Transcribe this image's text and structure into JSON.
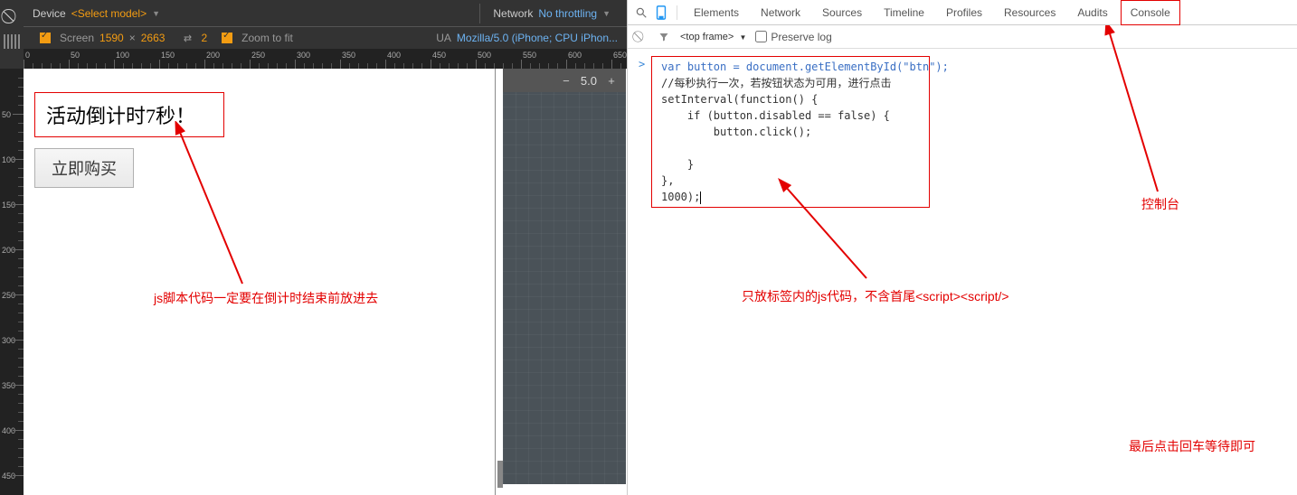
{
  "left": {
    "toolbar": {
      "device_label": "Device",
      "device_value": "<Select model>",
      "network_label": "Network",
      "network_value": "No throttling",
      "screen_label": "Screen",
      "screen_w": "1590",
      "screen_x": "×",
      "screen_h": "2663",
      "pixel_ratio_icon_val": "2",
      "zoom_label": "Zoom to fit",
      "ua_label": "UA",
      "ua_value": "Mozilla/5.0 (iPhone; CPU iPhon..."
    },
    "ruler_h": [
      "0",
      "50",
      "100",
      "150",
      "200",
      "250",
      "300",
      "350",
      "400",
      "450",
      "500",
      "550",
      "600",
      "650"
    ],
    "ruler_v": [
      "50",
      "100",
      "150",
      "200",
      "250",
      "300",
      "350",
      "400",
      "450"
    ],
    "countdown_text": "活动倒计时7秒！",
    "buy_btn": "立即购买",
    "dark_pane": {
      "minus": "−",
      "zoom": "5.0",
      "plus": "+"
    }
  },
  "devtools": {
    "tabs": {
      "elements": "Elements",
      "network": "Network",
      "sources": "Sources",
      "timeline": "Timeline",
      "profiles": "Profiles",
      "resources": "Resources",
      "audits": "Audits",
      "console": "Console"
    },
    "console_bar": {
      "frame": "<top frame>",
      "dropdown": "▼",
      "preserve": "Preserve log"
    },
    "code": {
      "l1": "var button = document.getElementById(\"btn\");",
      "l2": "//每秒执行一次，若按钮状态为可用，进行点击",
      "l3": "setInterval(function() {",
      "l4": "    if (button.disabled == false) {",
      "l5": "        button.click();",
      "l6": "",
      "l7": "    }",
      "l8": "},",
      "l9": "1000);"
    }
  },
  "annotations": {
    "left_note": "js脚本代码一定要在倒计时结束前放进去",
    "mid_note": "只放标签内的js代码，不含首尾<script><script/>",
    "top_right_note": "控制台",
    "bottom_right_note": "最后点击回车等待即可"
  }
}
